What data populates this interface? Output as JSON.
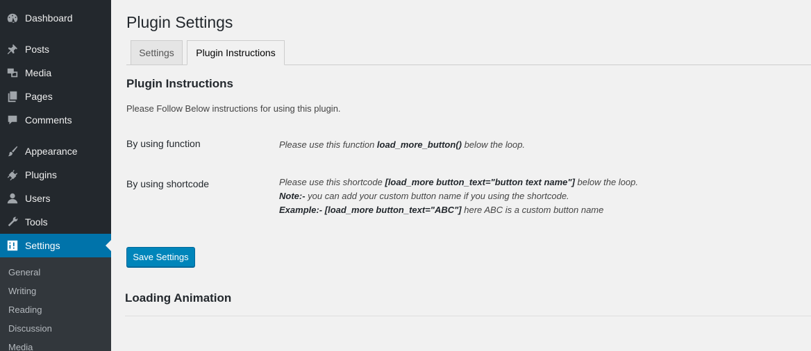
{
  "sidebar": {
    "items": [
      {
        "label": "Dashboard",
        "icon": "dashboard-icon"
      },
      {
        "label": "Posts",
        "icon": "pushpin-icon"
      },
      {
        "label": "Media",
        "icon": "media-icon"
      },
      {
        "label": "Pages",
        "icon": "pages-icon"
      },
      {
        "label": "Comments",
        "icon": "comments-icon"
      },
      {
        "label": "Appearance",
        "icon": "brush-icon"
      },
      {
        "label": "Plugins",
        "icon": "plug-icon"
      },
      {
        "label": "Users",
        "icon": "users-icon"
      },
      {
        "label": "Tools",
        "icon": "wrench-icon"
      },
      {
        "label": "Settings",
        "icon": "settings-sliders-icon",
        "active": true
      }
    ],
    "submenu": [
      "General",
      "Writing",
      "Reading",
      "Discussion",
      "Media"
    ]
  },
  "page": {
    "title": "Plugin Settings",
    "tabs": [
      {
        "label": "Settings",
        "active": false
      },
      {
        "label": "Plugin Instructions",
        "active": true
      }
    ]
  },
  "instructions": {
    "heading": "Plugin Instructions",
    "intro": "Please Follow Below instructions for using this plugin.",
    "function_row": {
      "label": "By using function",
      "text_before": "Please use this function ",
      "code": "load_more_button()",
      "text_after": " below the loop."
    },
    "shortcode_row": {
      "label": "By using shortcode",
      "line1_before": "Please use this shortcode ",
      "line1_code": "[load_more button_text=\"button text name\"]",
      "line1_after": " below the loop.",
      "note_label": "Note:-",
      "note_text": " you can add your custom button name if you using the shortcode.",
      "example_label": "Example:-",
      "example_code": " [load_more button_text=\"ABC\"]",
      "example_text": " here ABC is a custom button name"
    }
  },
  "save_button": "Save Settings",
  "loading_heading": "Loading Animation",
  "colors": {
    "sidebar_bg": "#23282d",
    "submenu_bg": "#32373c",
    "accent": "#0073aa",
    "button": "#0085ba",
    "page_bg": "#f1f1f1"
  }
}
